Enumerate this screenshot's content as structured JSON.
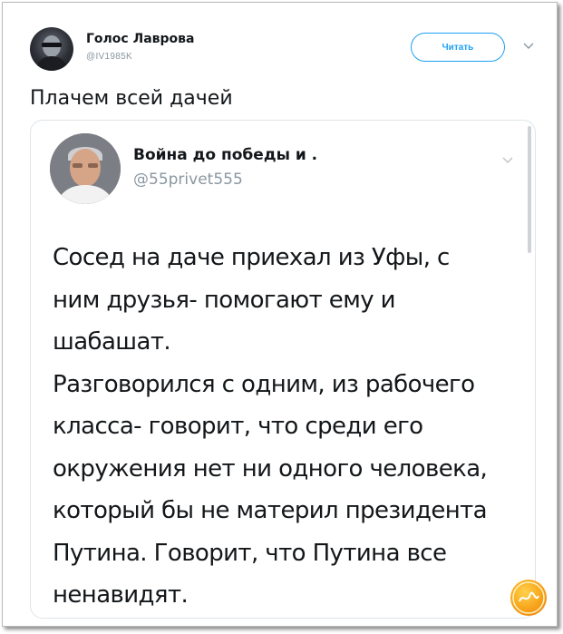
{
  "tweet": {
    "author_name": "Голос Лаврова",
    "author_handle": "@IV1985K",
    "follow_label": "Читать",
    "text": "Плачем всей дачей"
  },
  "quoted_tweet": {
    "author_name": "Война до победы и .",
    "author_handle": "@55privet555",
    "lines": [
      "Сосед на даче приехал из Уфы, с",
      "ним друзья- помогают ему и",
      "шабашат.",
      "Разговорился с одним, из рабочего",
      "класса- говорит, что среди его",
      "окружения нет ни одного человека,",
      "который бы не материл президента",
      "Путина. Говорит, что Путина все",
      "ненавидят."
    ]
  },
  "icons": {
    "menu": "chevron-down-icon",
    "watermark": "watermark-logo"
  },
  "colors": {
    "accent": "#1da1f2",
    "text": "#14171a",
    "secondary": "#8a96a0"
  }
}
